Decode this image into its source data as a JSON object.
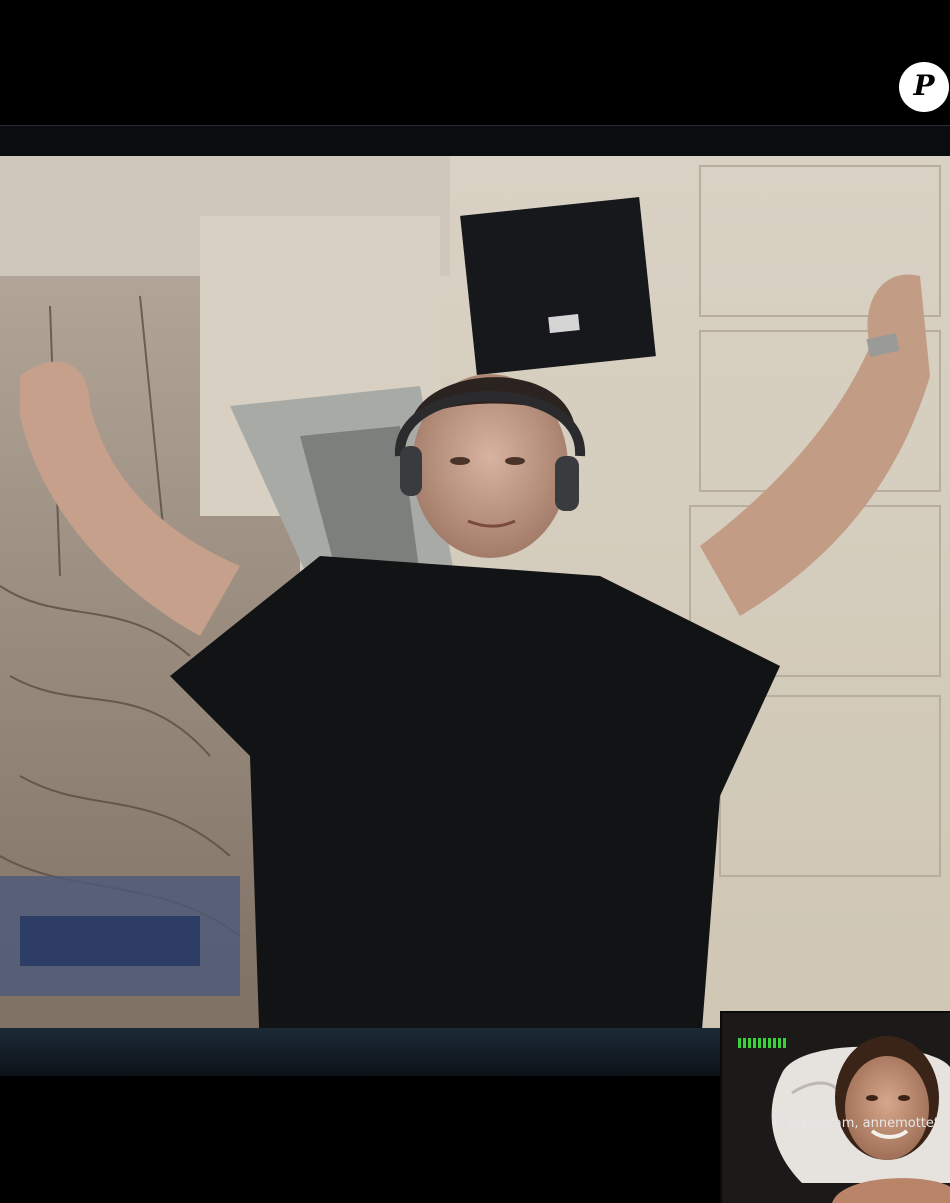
{
  "logo": {
    "letter": "P",
    "icon": "publication-logo-icon"
  },
  "credit": {
    "text": "© Instagram, annemottet"
  },
  "call": {
    "main_feed": "astronaut-video-feed",
    "pip_feed": "self-view-video-feed",
    "signal_bars": 10,
    "signal_color": "#3ad23a"
  },
  "colors": {
    "background": "#000000",
    "credit_text": "#e6e6e6"
  }
}
